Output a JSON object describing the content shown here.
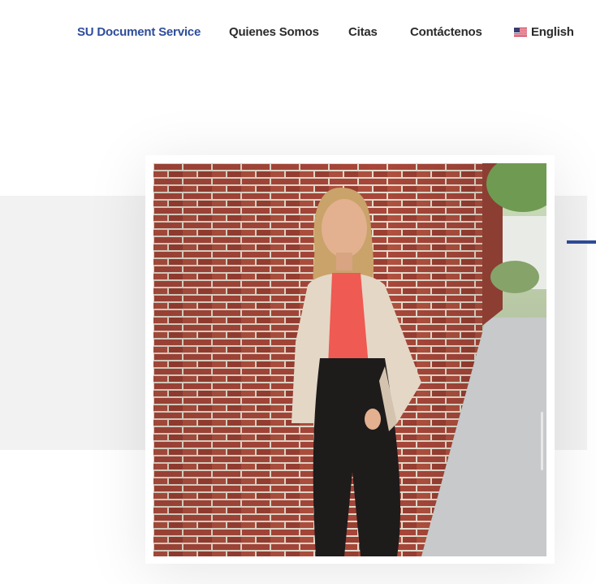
{
  "nav": {
    "items": [
      {
        "label": "SU Document Service",
        "active": true
      },
      {
        "label": "Quienes Somos",
        "active": false
      },
      {
        "label": "Citas",
        "active": false
      },
      {
        "label": "Contáctenos",
        "active": false
      }
    ],
    "language": {
      "label": "English",
      "flag_icon": "us-flag-icon"
    }
  },
  "colors": {
    "accent": "#2e4c9a",
    "band": "#f2f2f2",
    "text": "#2b2b2b"
  },
  "hero": {
    "photo_icon": "portrait-photo"
  }
}
